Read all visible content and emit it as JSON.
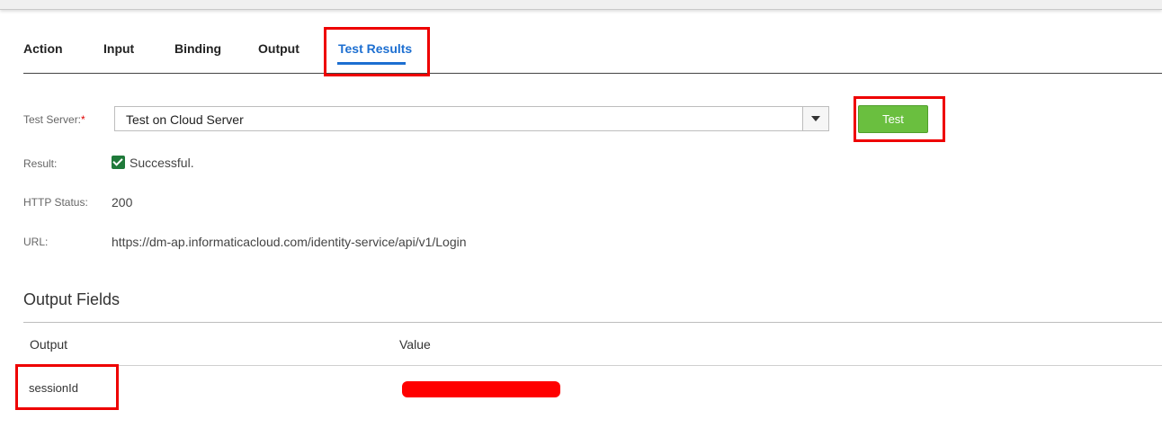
{
  "tabs": [
    {
      "label": "Action"
    },
    {
      "label": "Input"
    },
    {
      "label": "Binding"
    },
    {
      "label": "Output"
    },
    {
      "label": "Test Results",
      "active": true
    }
  ],
  "form": {
    "test_server_label": "Test Server:",
    "required_marker": "*",
    "test_server_value": "Test on Cloud Server",
    "test_button_label": "Test",
    "result_label": "Result:",
    "result_value": "Successful.",
    "http_status_label": "HTTP Status:",
    "http_status_value": "200",
    "url_label": "URL:",
    "url_value": "https://dm-ap.informaticacloud.com/identity-service/api/v1/Login"
  },
  "output_fields": {
    "title": "Output Fields",
    "columns": [
      "Output",
      "Value"
    ],
    "rows": [
      {
        "output": "sessionId",
        "value_redacted": true
      }
    ]
  },
  "colors": {
    "accent": "#1d6fd1",
    "test_button": "#6abf3f",
    "success_check": "#1f7a3a",
    "highlight": "#ee0000",
    "required": "#e00000"
  },
  "icons": {
    "dropdown": "chevron-down-icon",
    "result": "checkbox-checked-icon"
  }
}
